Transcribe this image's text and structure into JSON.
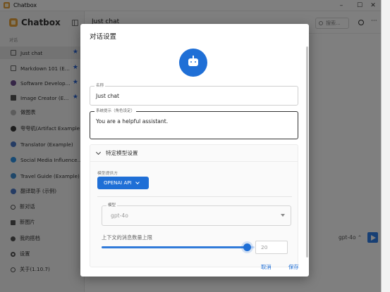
{
  "window": {
    "title": "Chatbox",
    "controls": {
      "minimize": "–",
      "maximize": "☐",
      "close": "✕"
    }
  },
  "sidebar": {
    "brand": "Chatbox",
    "section_label": "对话",
    "items": [
      {
        "label": "Just chat",
        "icon": "chat-icon",
        "starred": true,
        "active": true
      },
      {
        "label": "Markdown 101 (E…",
        "icon": "chat-icon",
        "starred": true
      },
      {
        "label": "Software Develop…",
        "icon": "avatar-icon",
        "starred": true
      },
      {
        "label": "Image Creator (E…",
        "icon": "image-icon",
        "starred": true
      },
      {
        "label": "做图表",
        "icon": "chart-avatar-icon"
      },
      {
        "label": "夸夸机(Artifact Example)",
        "icon": "avatar-icon"
      },
      {
        "label": "Translator (Example)",
        "icon": "avatar-icon"
      },
      {
        "label": "Social Media Influence…",
        "icon": "twitter-icon"
      },
      {
        "label": "Travel Guide (Example)",
        "icon": "globe-icon"
      },
      {
        "label": "翻译助手 (示例)",
        "icon": "avatar-icon"
      }
    ],
    "star_glyph": "★",
    "footer": [
      {
        "label": "新对话",
        "icon": "plus-circle-icon"
      },
      {
        "label": "新图片",
        "icon": "image-plus-icon"
      },
      {
        "label": "我的搭档",
        "icon": "partner-icon"
      },
      {
        "label": "设置",
        "icon": "gear-icon"
      },
      {
        "label": "关于(1.10.7)",
        "icon": "info-icon"
      }
    ]
  },
  "header": {
    "chat_title": "Just chat",
    "search_placeholder": "搜索...",
    "more_glyph": "···"
  },
  "composer": {
    "model": "gpt-4o ⌃"
  },
  "dialog": {
    "title": "对话设置",
    "name_label": "名称",
    "name_value": "Just chat",
    "system_prompt_label": "系统提示（角色设定）",
    "system_prompt_value": "You are a helpful assistant.",
    "model_section_title": "特定模型设置",
    "provider_label": "模型提供方",
    "provider_value": "OPENAI API",
    "model_label": "模型",
    "model_value": "gpt-4o",
    "context_label": "上下文的消息数量上限",
    "context_value": "20",
    "cancel_label": "取消",
    "save_label": "保存"
  },
  "colors": {
    "accent": "#1f6fd6",
    "star": "#2a66d9",
    "brand": "#e8a33a"
  }
}
